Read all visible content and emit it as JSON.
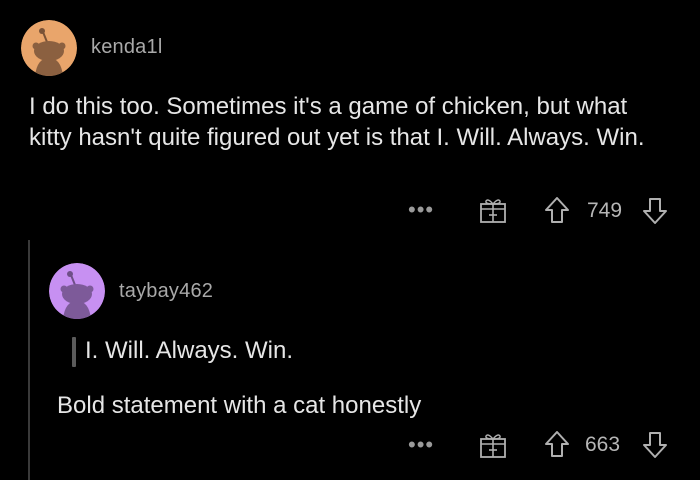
{
  "comments": [
    {
      "username": "kenda1l",
      "text": "I do this too. Sometimes it's a game of chicken, but what kitty hasn't quite figured out yet is that I. Will. Always. Win.",
      "more_label": "•••",
      "score": "749",
      "avatar_color": "#e9a56b"
    },
    {
      "username": "taybay462",
      "quote": "I. Will. Always. Win.",
      "text": "Bold statement with a cat honestly",
      "more_label": "•••",
      "score": "663",
      "avatar_color": "#c790f2"
    }
  ],
  "icons": {
    "award": "award-icon",
    "upvote": "upvote-icon",
    "downvote": "downvote-icon",
    "more": "more-icon"
  }
}
